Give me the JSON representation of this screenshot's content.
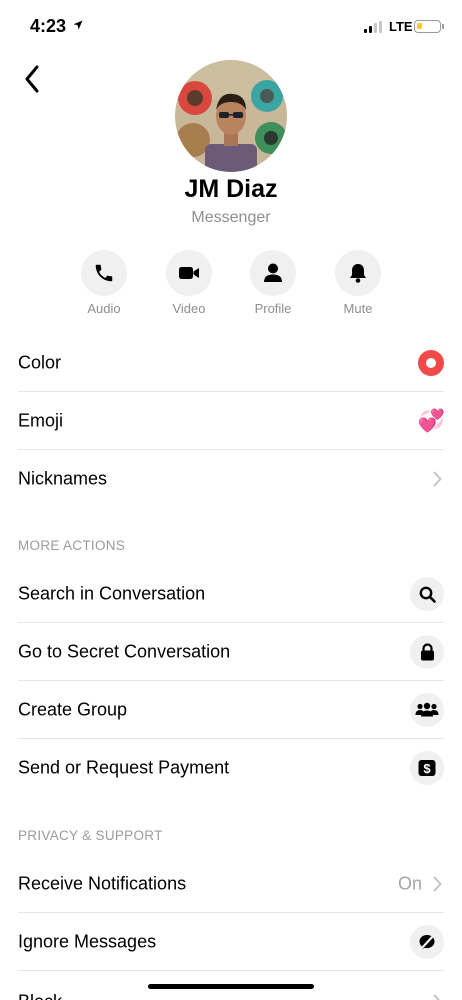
{
  "status_bar": {
    "time": "4:23",
    "network": "LTE"
  },
  "profile": {
    "name": "JM Diaz",
    "subtitle": "Messenger"
  },
  "actions": [
    {
      "label": "Audio",
      "icon": "phone-icon"
    },
    {
      "label": "Video",
      "icon": "video-camera-icon"
    },
    {
      "label": "Profile",
      "icon": "person-icon"
    },
    {
      "label": "Mute",
      "icon": "bell-icon"
    }
  ],
  "rows": {
    "color": {
      "label": "Color",
      "accent": "#f04a4a"
    },
    "emoji": {
      "label": "Emoji",
      "glyph": "💞"
    },
    "nicknames": {
      "label": "Nicknames"
    }
  },
  "more_actions": {
    "header": "MORE ACTIONS",
    "items": [
      {
        "label": "Search in Conversation",
        "icon": "search-icon"
      },
      {
        "label": "Go to Secret Conversation",
        "icon": "lock-icon"
      },
      {
        "label": "Create Group",
        "icon": "group-icon"
      },
      {
        "label": "Send or Request Payment",
        "icon": "dollar-icon"
      }
    ]
  },
  "privacy_support": {
    "header": "PRIVACY & SUPPORT",
    "items": [
      {
        "label": "Receive Notifications",
        "value": "On"
      },
      {
        "label": "Ignore Messages",
        "icon": "ignore-icon"
      },
      {
        "label": "Block"
      }
    ]
  }
}
